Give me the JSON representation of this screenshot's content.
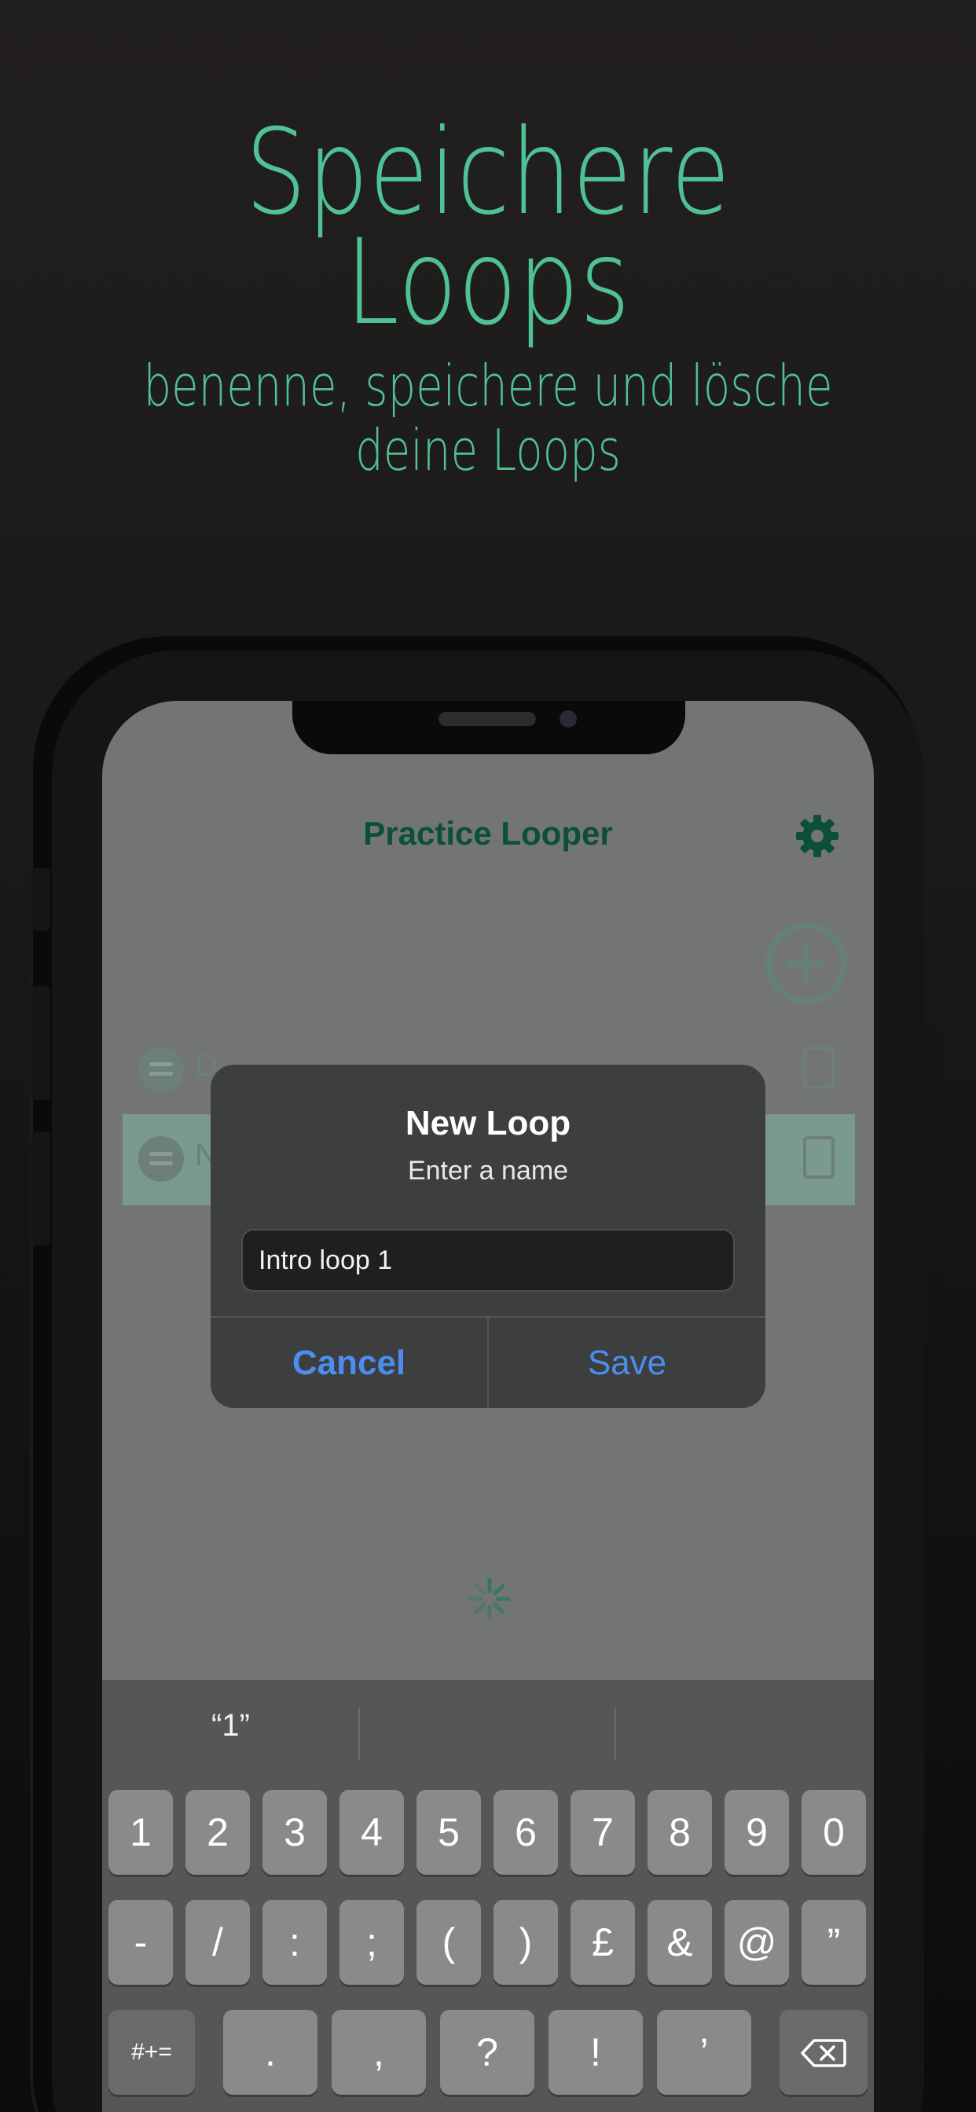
{
  "headline": {
    "title_line1": "Speichere",
    "title_line2": "Loops",
    "subtitle_line1": "benenne, speichere und lösche",
    "subtitle_line2": "deine Loops"
  },
  "app": {
    "title": "Practice Looper",
    "settings_icon": "gear-icon",
    "add_icon": "plus-circle-icon",
    "rows": [
      {
        "label": "D",
        "source_icon": "spotify-icon",
        "action_icon": "bookmark-icon"
      },
      {
        "label": "N",
        "source_icon": "spotify-icon",
        "action_icon": "bookmark-icon"
      }
    ]
  },
  "dialog": {
    "title": "New Loop",
    "message": "Enter a name",
    "input_value": "Intro loop 1",
    "cancel_label": "Cancel",
    "save_label": "Save"
  },
  "keyboard": {
    "suggestions": [
      "“1”",
      "",
      ""
    ],
    "row1": [
      "1",
      "2",
      "3",
      "4",
      "5",
      "6",
      "7",
      "8",
      "9",
      "0"
    ],
    "row2": [
      "-",
      "/",
      ":",
      ";",
      "(",
      ")",
      "£",
      "&",
      "@",
      "”"
    ],
    "row3": {
      "shift_label": "#+=",
      "keys": [
        ".",
        ",",
        "?",
        "!",
        "’"
      ],
      "delete_icon": "backspace-icon"
    }
  },
  "colors": {
    "accent": "#4fc195",
    "app_title": "#0c4f38",
    "dialog_button": "#4b8ef0"
  }
}
